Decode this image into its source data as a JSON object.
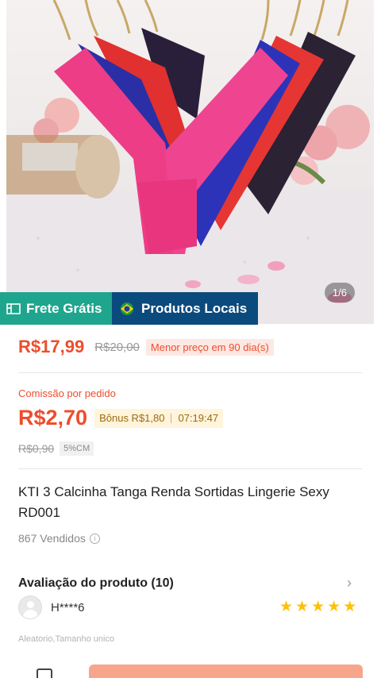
{
  "product_image": {
    "page_indicator": "1/6"
  },
  "badges": {
    "frete": "Frete Grátis",
    "local": "Produtos Locais"
  },
  "price": {
    "current": "R$17,99",
    "original": "R$20,00",
    "tag": "Menor preço em 90 dia(s)"
  },
  "commission": {
    "label": "Comissão por pedido",
    "amount": "R$2,70",
    "bonus": "Bônus R$1,80",
    "timer": "07:19:47",
    "old_amount": "R$0,90",
    "rate": "5%CM"
  },
  "product": {
    "title": "KTI 3 Calcinha Tanga Renda Sortidas Lingerie Sexy RD001",
    "sold": "867 Vendidos"
  },
  "reviews": {
    "header": "Avaliação do produto (10)",
    "reviewer": "H****6",
    "rating": 5,
    "variation": "Aleatorio,Tamanho unico"
  },
  "colors": {
    "accent": "#ee4d2d",
    "frete_green": "#1fa58e",
    "local_blue": "#0b4a7d",
    "star": "#ffc107"
  }
}
